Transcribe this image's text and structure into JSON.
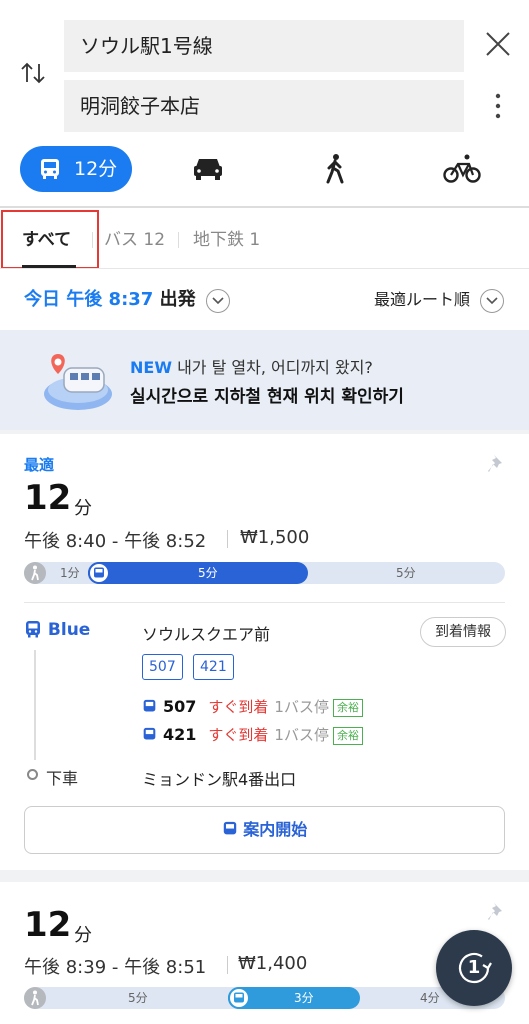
{
  "search": {
    "origin": "ソウル駅1号線",
    "destination": "明洞餃子本店"
  },
  "modes": {
    "selected_label": "12分"
  },
  "tabs": [
    {
      "label": "すべて"
    },
    {
      "label": "バス 12"
    },
    {
      "label": "地下鉄 1"
    }
  ],
  "departure": {
    "day": "今日",
    "time": "午後 8:37",
    "action": "出発"
  },
  "sort_label": "最適ルート順",
  "banner": {
    "tag": "NEW",
    "line1": "내가 탈 열차, 어디까지 왔지?",
    "line2": "실시간으로 지하철 현재 위치 확인하기"
  },
  "route1": {
    "tag": "最適",
    "duration": "12",
    "unit": "分",
    "range": "午後 8:40 - 午後 8:52",
    "fare": "₩1,500",
    "segments": [
      {
        "mode": "walk",
        "label": "1分",
        "minutes": 1
      },
      {
        "mode": "bus",
        "label": "5分",
        "minutes": 5
      },
      {
        "mode": "walk",
        "label": "5分",
        "minutes": 5
      }
    ],
    "bus_line": "Blue",
    "board_stop": "ソウルスクエア前",
    "arrival_info_button": "到着情報",
    "route_numbers": [
      "507",
      "421"
    ],
    "arrivals": [
      {
        "num": "507",
        "status": "すぐ到着",
        "stops": "1バス停",
        "badge": "余裕"
      },
      {
        "num": "421",
        "status": "すぐ到着",
        "stops": "1バス停",
        "badge": "余裕"
      }
    ],
    "alight_label": "下車",
    "alight_stop": "ミョンドン駅4番出口",
    "guide_button": "案内開始"
  },
  "route2": {
    "duration": "12",
    "unit": "分",
    "range": "午後 8:39 - 午後 8:51",
    "fare": "₩1,400",
    "segments": [
      {
        "mode": "walk",
        "label": "5分",
        "minutes": 5
      },
      {
        "mode": "bus",
        "label": "3分",
        "minutes": 3
      },
      {
        "mode": "walk",
        "label": "4分",
        "minutes": 4
      }
    ]
  },
  "fab_label": "1",
  "colors": {
    "accent": "#1a7cf0",
    "bus_blue": "#2a63d6",
    "highlight": "#e53935",
    "badge_green": "#4caf50"
  }
}
